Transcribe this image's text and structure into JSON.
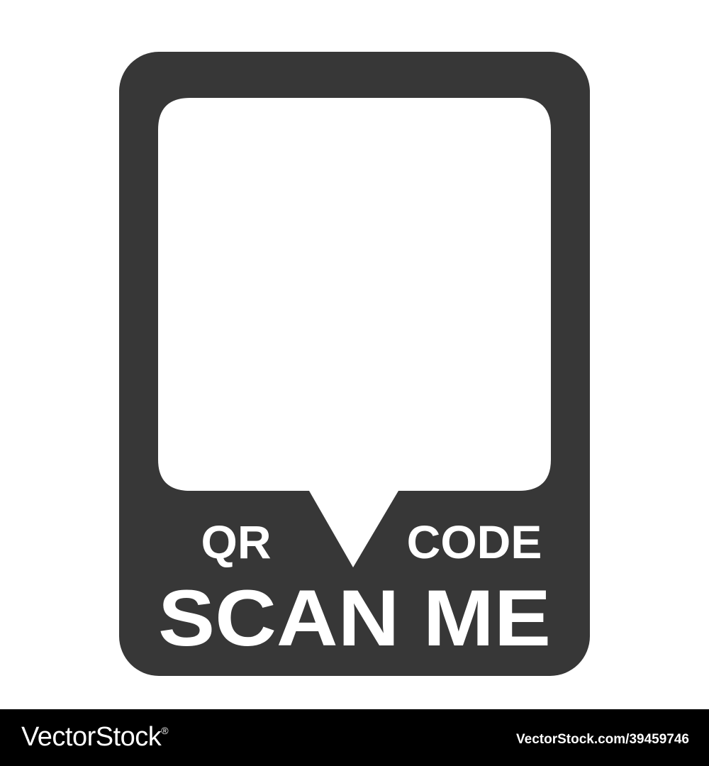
{
  "frame": {
    "fill_color": "#373737",
    "window_color": "#ffffff",
    "label_left": "QR",
    "label_right": "CODE",
    "label_main": "SCAN ME"
  },
  "footer": {
    "background": "#000000",
    "logo_text": "VectorStock",
    "logo_mark": "®",
    "image_id": "VectorStock.com/39459746"
  }
}
